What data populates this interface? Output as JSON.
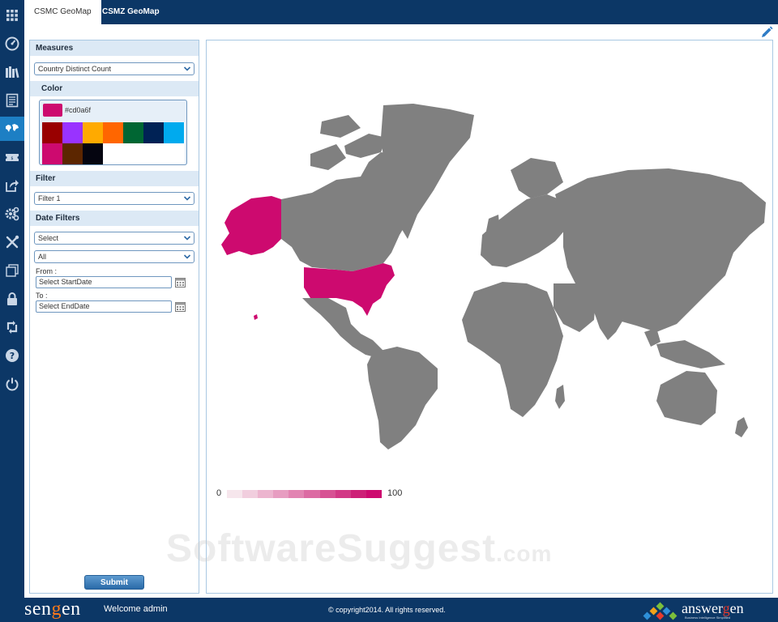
{
  "tabs": [
    {
      "label": "CSMC GeoMap",
      "active": true
    },
    {
      "label": "CSMZ GeoMap",
      "active": false
    }
  ],
  "rail_icons": [
    "apps-grid-icon",
    "dashboard-gauge-icon",
    "library-icon",
    "report-icon",
    "world-map-icon",
    "ticket-icon",
    "share-export-icon",
    "settings-gears-icon",
    "tools-icon",
    "pages-icon",
    "lock-icon",
    "sync-icon",
    "help-icon",
    "power-icon"
  ],
  "panel": {
    "measures": {
      "heading": "Measures",
      "selected": "Country  Distinct Count"
    },
    "color": {
      "heading": "Color",
      "current": "#cd0a6f",
      "swatches": [
        "#990000",
        "#9933ff",
        "#ffaa00",
        "#ff6600",
        "#006633",
        "#002255",
        "#00aaee",
        "#cd0a6f",
        "#5c2600",
        "#050510"
      ]
    },
    "filter": {
      "heading": "Filter",
      "selected": "Filter 1"
    },
    "date_filters": {
      "heading": "Date Filters",
      "select_1": "Select",
      "select_2": "All",
      "from_label": "From :",
      "from_placeholder": "Select StartDate",
      "to_label": "To :",
      "to_placeholder": "Select EndDate"
    },
    "submit_label": "Submit"
  },
  "map": {
    "land_color": "#808080",
    "highlight_color": "#cd0a6f",
    "highlighted_regions": [
      "United States",
      "Alaska",
      "Hawaii"
    ],
    "legend": {
      "min": "0",
      "max": "100",
      "colors": [
        "#f6e6ec",
        "#f1cede",
        "#ecb5cf",
        "#e79dc1",
        "#e284b2",
        "#dc6ba3",
        "#d75294",
        "#d23986",
        "#cd2077",
        "#cd0a6f"
      ]
    }
  },
  "watermark": {
    "main": "SoftwareSuggest",
    "suffix": ".com"
  },
  "footer": {
    "brand_prefix": "sen",
    "brand_g": "g",
    "brand_suffix": "en",
    "welcome": "Welcome admin",
    "copyright": "© copyright2014. All rights reserved.",
    "logo_prefix": "answer",
    "logo_g": "g",
    "logo_suffix": "en",
    "logo_tagline": "Business Intelligence Simplified"
  }
}
